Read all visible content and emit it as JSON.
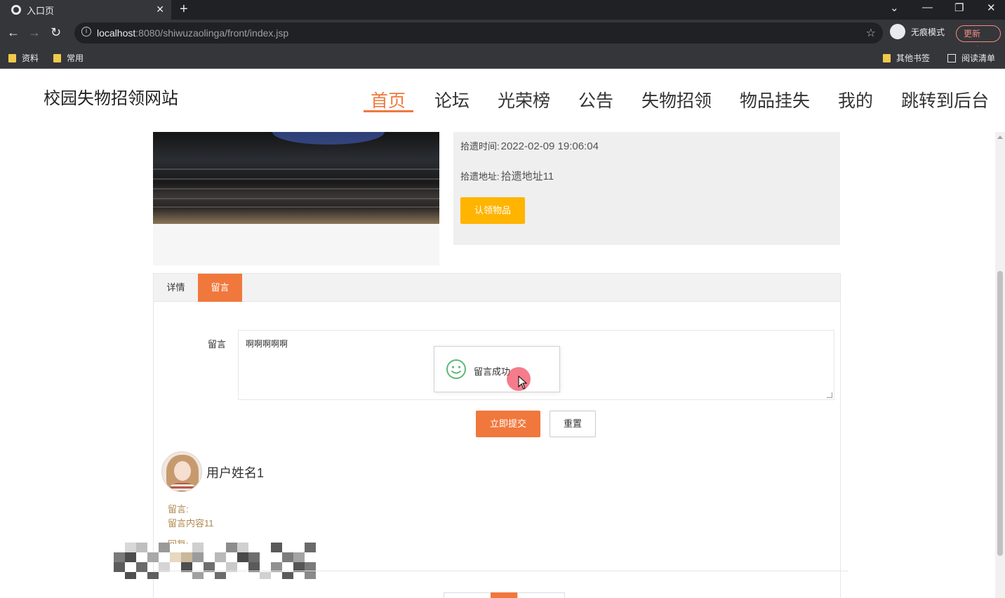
{
  "browser": {
    "tab_title": "入口页",
    "url_host": "localhost",
    "url_rest": ":8080/shiwuzaolinga/front/index.jsp",
    "incognito_label": "无痕模式",
    "update_label": "更新",
    "bookmarks": [
      "资料",
      "常用"
    ],
    "bookmarks_right": [
      "其他书签",
      "阅读清单"
    ]
  },
  "site": {
    "logo": "校园失物招领网站",
    "nav": [
      "首页",
      "论坛",
      "光荣榜",
      "公告",
      "失物招领",
      "物品挂失",
      "我的",
      "跳转到后台"
    ],
    "active_nav": "首页"
  },
  "item": {
    "time_label": "拾遗时间:",
    "time_value": "2022-02-09 19:06:04",
    "addr_label": "拾遗地址:",
    "addr_value": "拾遗地址11",
    "claim_button": "认领物品"
  },
  "tabs": [
    "详情",
    "留言"
  ],
  "active_tab": "留言",
  "comment_form": {
    "label": "留言",
    "value": "啊啊啊啊啊",
    "submit": "立即提交",
    "reset": "重置"
  },
  "toast": {
    "message": "留言成功"
  },
  "comments": [
    {
      "username": "用户姓名1",
      "comment_label": "留言:",
      "comment_text": "留言内容11",
      "reply_label": "回复:"
    }
  ],
  "colors": {
    "accent": "#f0783c",
    "claim": "#ffb400",
    "comment_text": "#b08850"
  }
}
